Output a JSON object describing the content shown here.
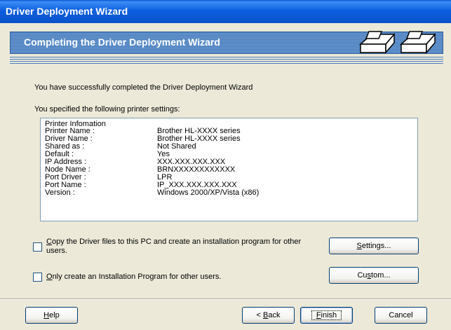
{
  "window": {
    "title": "Driver Deployment Wizard"
  },
  "banner": {
    "title": "Completing the Driver Deployment Wizard",
    "icon": "printer-icon"
  },
  "main": {
    "completed_text": "You have successfully completed the Driver Deployment Wizard",
    "specified_text": "You specified the following printer settings:"
  },
  "settings": {
    "header": "Printer Infomation",
    "rows": [
      {
        "label": "Printer Name :",
        "value": "Brother HL-XXXX series"
      },
      {
        "label": "Driver Name :",
        "value": "Brother HL-XXXX series"
      },
      {
        "label": "Shared as :",
        "value": "Not Shared"
      },
      {
        "label": "Default :",
        "value": "Yes"
      },
      {
        "label": "IP Address :",
        "value": "XXX.XXX.XXX.XXX"
      },
      {
        "label": "Node Name :",
        "value": "BRNXXXXXXXXXXXX"
      },
      {
        "label": "Port Driver :",
        "value": "LPR"
      },
      {
        "label": "Port Name :",
        "value": "IP_XXX.XXX.XXX.XXX"
      },
      {
        "label": "Version :",
        "value": "Windows 2000/XP/Vista (x86)"
      }
    ]
  },
  "options": {
    "copy": {
      "first": "C",
      "rest_line1": "opy the Driver files to this PC and create an installation program for other",
      "line2": "users.",
      "checked": false
    },
    "only": {
      "first": "O",
      "rest": "nly create an Installation Program for other users.",
      "checked": false
    }
  },
  "buttons": {
    "settings": {
      "first": "S",
      "rest": "ettings..."
    },
    "custom": {
      "pre": "Cu",
      "u": "s",
      "rest": "tom..."
    },
    "help": {
      "first": "H",
      "rest": "elp"
    },
    "back": {
      "pre": "< ",
      "u": "B",
      "rest": "ack"
    },
    "finish": {
      "first": "F",
      "rest": "inish"
    },
    "cancel": "Cancel"
  }
}
